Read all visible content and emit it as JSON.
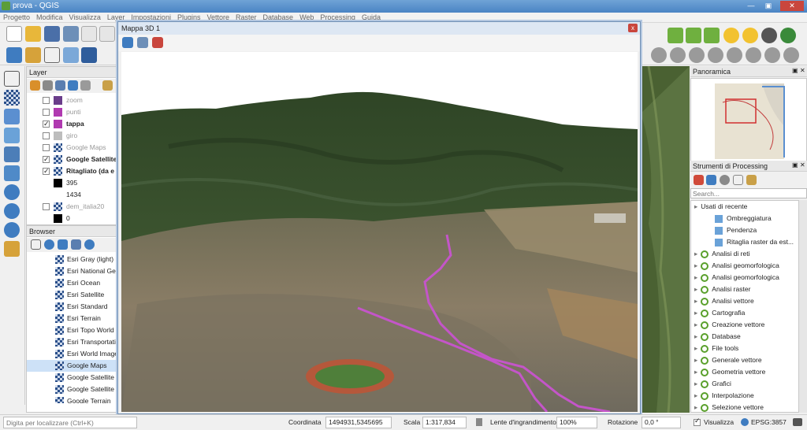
{
  "window": {
    "title": "prova - QGIS"
  },
  "menu": [
    "Progetto",
    "Modifica",
    "Visualizza",
    "Layer",
    "Impostazioni",
    "Plugins",
    "Vettore",
    "Raster",
    "Database",
    "Web",
    "Processing",
    "Guida"
  ],
  "layers_panel": {
    "title": "Layer",
    "items": [
      {
        "label": "zoom",
        "checked": false,
        "bold": false,
        "muted": true
      },
      {
        "label": "punti",
        "checked": false,
        "bold": false,
        "muted": true
      },
      {
        "label": "tappa",
        "checked": true,
        "bold": true,
        "muted": false
      },
      {
        "label": "giro",
        "checked": false,
        "bold": false,
        "muted": true
      },
      {
        "label": "Google Maps",
        "checked": false,
        "bold": false,
        "muted": true
      },
      {
        "label": "Google Satellite",
        "checked": true,
        "bold": true,
        "muted": false
      },
      {
        "label": "Ritagliato (da e",
        "checked": true,
        "bold": true,
        "muted": false
      },
      {
        "label": "395",
        "legend": true
      },
      {
        "label": "1434",
        "legend": true
      },
      {
        "label": "dem_italia20",
        "checked": false,
        "bold": false,
        "muted": true
      },
      {
        "label": "0",
        "legend": true
      }
    ]
  },
  "browser_panel": {
    "title": "Browser",
    "items": [
      "Esri Gray (light)",
      "Esri National Geog",
      "Esri Ocean",
      "Esri Satellite",
      "Esri Standard",
      "Esri Terrain",
      "Esri Topo World",
      "Esri Transportation",
      "Esri World Imager",
      "Google Maps",
      "Google Satellite",
      "Google Satellite H",
      "Google Terrain"
    ]
  },
  "map3d": {
    "title": "Mappa 3D 1",
    "close_label": "x"
  },
  "overview_panel": {
    "title": "Panoramica"
  },
  "processing_panel": {
    "title": "Strumenti di Processing",
    "search_placeholder": "Search...",
    "recent_group": "Usati di recente",
    "recent": [
      "Ombreggiatura",
      "Pendenza",
      "Ritaglia raster da est..."
    ],
    "groups": [
      "Analisi di reti",
      "Analisi geomorfologica",
      "Analisi geomorfologica",
      "Analisi raster",
      "Analisi vettore",
      "Cartografia",
      "Creazione vettore",
      "Database",
      "File tools",
      "Generale vettore",
      "Geometria vettore",
      "Grafici",
      "Interpolazione",
      "Selezione vettore"
    ]
  },
  "statusbar": {
    "locator_placeholder": "Digita per localizzare (Ctrl+K)",
    "coord_label": "Coordinata",
    "coord_value": "1494931,5345695",
    "scale_label": "Scala",
    "scale_value": "1:317,834",
    "magnifier_label": "Lente d'ingrandimento",
    "magnifier_value": "100%",
    "rotation_label": "Rotazione",
    "rotation_value": "0,0 °",
    "render_label": "Visualizza",
    "crs": "EPSG:3857"
  },
  "colors": {
    "accent": "#4a84c4",
    "route": "#c455c9",
    "processing_icon": "#5aa02c"
  }
}
